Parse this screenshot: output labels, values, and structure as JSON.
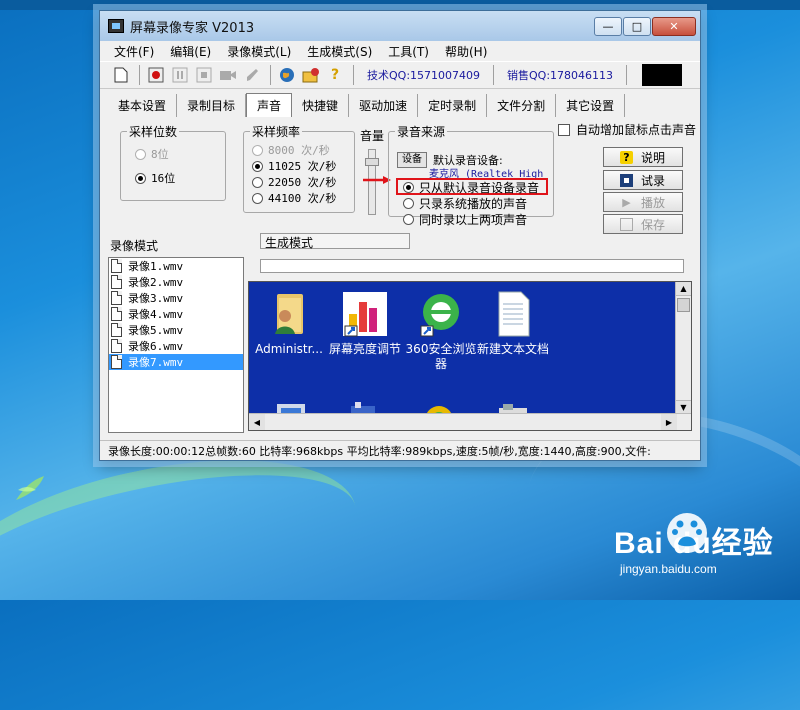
{
  "desktop": {
    "top_strip_text": "",
    "watermark": {
      "brand": "Bai du经验",
      "url": "jingyan.baidu.com"
    }
  },
  "window": {
    "title": "屏幕录像专家 V2013",
    "controls": {
      "minimize": "—",
      "maximize": "□",
      "close": "✕"
    }
  },
  "menu": [
    "文件(F)",
    "编辑(E)",
    "录像模式(L)",
    "生成模式(S)",
    "工具(T)",
    "帮助(H)"
  ],
  "toolbar": {
    "icons": [
      "new-file-icon",
      "record-icon",
      "pause-icon",
      "stop-icon",
      "camera-icon",
      "brush-icon",
      "globe-icon",
      "folder-settings-icon",
      "help-icon"
    ],
    "tech_qq": "技术QQ:1571007409",
    "sales_qq": "销售QQ:178046113"
  },
  "tabs": [
    {
      "label": "基本设置",
      "active": false
    },
    {
      "label": "录制目标",
      "active": false
    },
    {
      "label": "声音",
      "active": true
    },
    {
      "label": "快捷键",
      "active": false
    },
    {
      "label": "驱动加速",
      "active": false
    },
    {
      "label": "定时录制",
      "active": false
    },
    {
      "label": "文件分割",
      "active": false
    },
    {
      "label": "其它设置",
      "active": false
    }
  ],
  "sound": {
    "bit_depth": {
      "title": "采样位数",
      "options": [
        "8位",
        "16位"
      ],
      "selected": 1
    },
    "sample_rate": {
      "title": "采样频率",
      "options": [
        "8000 次/秒",
        "11025 次/秒",
        "22050 次/秒",
        "44100 次/秒"
      ],
      "selected": 1
    },
    "volume_label": "音量",
    "source": {
      "title": "录音来源",
      "device_button": "设备",
      "device_label": "默认录音设备:",
      "device_name": "麦克风 (Realtek High",
      "options": [
        "只从默认录音设备录音",
        "只录系统播放的声音",
        "同时录以上两项声音"
      ],
      "selected": 0
    },
    "auto_cursor_checkbox": "自动增加鼠标点击声音",
    "buttons": [
      {
        "label": "说明",
        "icon": "help-icon",
        "enabled": true
      },
      {
        "label": "试录",
        "icon": "record-icon",
        "enabled": true
      },
      {
        "label": "播放",
        "icon": "play-icon",
        "enabled": false
      },
      {
        "label": "保存",
        "icon": "save-icon",
        "enabled": false
      }
    ]
  },
  "recording_mode": {
    "header": "录像模式",
    "files": [
      "录像1.wmv",
      "录像2.wmv",
      "录像3.wmv",
      "录像4.wmv",
      "录像5.wmv",
      "录像6.wmv",
      "录像7.wmv"
    ],
    "selected": 6
  },
  "generate_mode": {
    "header": "生成模式"
  },
  "preview_icons": [
    {
      "label": "Administr...",
      "icon": "user-folder-icon"
    },
    {
      "label": "屏幕亮度调节",
      "icon": "brightness-shortcut-icon"
    },
    {
      "label": "360安全浏览器",
      "icon": "browser-360-icon"
    },
    {
      "label": "新建文本文档",
      "icon": "text-document-icon"
    }
  ],
  "status": "录像长度:00:00:12总帧数:60 比特率:968kbps 平均比特率:989kbps,速度:5帧/秒,宽度:1440,高度:900,文件:",
  "colors": {
    "desktop_blue": "#1b8fdc",
    "preview_bg": "#0d2fa8",
    "selection": "#3399ff",
    "highlight_red": "#e0141a"
  }
}
